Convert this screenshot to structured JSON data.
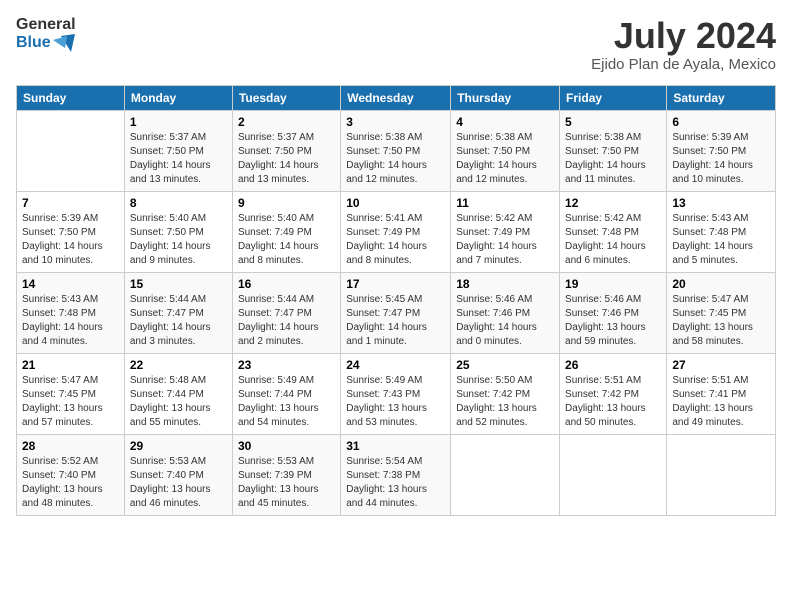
{
  "header": {
    "logo_line1": "General",
    "logo_line2": "Blue",
    "month_title": "July 2024",
    "location": "Ejido Plan de Ayala, Mexico"
  },
  "columns": [
    "Sunday",
    "Monday",
    "Tuesday",
    "Wednesday",
    "Thursday",
    "Friday",
    "Saturday"
  ],
  "weeks": [
    [
      {
        "day": "",
        "info": ""
      },
      {
        "day": "1",
        "info": "Sunrise: 5:37 AM\nSunset: 7:50 PM\nDaylight: 14 hours\nand 13 minutes."
      },
      {
        "day": "2",
        "info": "Sunrise: 5:37 AM\nSunset: 7:50 PM\nDaylight: 14 hours\nand 13 minutes."
      },
      {
        "day": "3",
        "info": "Sunrise: 5:38 AM\nSunset: 7:50 PM\nDaylight: 14 hours\nand 12 minutes."
      },
      {
        "day": "4",
        "info": "Sunrise: 5:38 AM\nSunset: 7:50 PM\nDaylight: 14 hours\nand 12 minutes."
      },
      {
        "day": "5",
        "info": "Sunrise: 5:38 AM\nSunset: 7:50 PM\nDaylight: 14 hours\nand 11 minutes."
      },
      {
        "day": "6",
        "info": "Sunrise: 5:39 AM\nSunset: 7:50 PM\nDaylight: 14 hours\nand 10 minutes."
      }
    ],
    [
      {
        "day": "7",
        "info": "Sunrise: 5:39 AM\nSunset: 7:50 PM\nDaylight: 14 hours\nand 10 minutes."
      },
      {
        "day": "8",
        "info": "Sunrise: 5:40 AM\nSunset: 7:50 PM\nDaylight: 14 hours\nand 9 minutes."
      },
      {
        "day": "9",
        "info": "Sunrise: 5:40 AM\nSunset: 7:49 PM\nDaylight: 14 hours\nand 8 minutes."
      },
      {
        "day": "10",
        "info": "Sunrise: 5:41 AM\nSunset: 7:49 PM\nDaylight: 14 hours\nand 8 minutes."
      },
      {
        "day": "11",
        "info": "Sunrise: 5:42 AM\nSunset: 7:49 PM\nDaylight: 14 hours\nand 7 minutes."
      },
      {
        "day": "12",
        "info": "Sunrise: 5:42 AM\nSunset: 7:48 PM\nDaylight: 14 hours\nand 6 minutes."
      },
      {
        "day": "13",
        "info": "Sunrise: 5:43 AM\nSunset: 7:48 PM\nDaylight: 14 hours\nand 5 minutes."
      }
    ],
    [
      {
        "day": "14",
        "info": "Sunrise: 5:43 AM\nSunset: 7:48 PM\nDaylight: 14 hours\nand 4 minutes."
      },
      {
        "day": "15",
        "info": "Sunrise: 5:44 AM\nSunset: 7:47 PM\nDaylight: 14 hours\nand 3 minutes."
      },
      {
        "day": "16",
        "info": "Sunrise: 5:44 AM\nSunset: 7:47 PM\nDaylight: 14 hours\nand 2 minutes."
      },
      {
        "day": "17",
        "info": "Sunrise: 5:45 AM\nSunset: 7:47 PM\nDaylight: 14 hours\nand 1 minute."
      },
      {
        "day": "18",
        "info": "Sunrise: 5:46 AM\nSunset: 7:46 PM\nDaylight: 14 hours\nand 0 minutes."
      },
      {
        "day": "19",
        "info": "Sunrise: 5:46 AM\nSunset: 7:46 PM\nDaylight: 13 hours\nand 59 minutes."
      },
      {
        "day": "20",
        "info": "Sunrise: 5:47 AM\nSunset: 7:45 PM\nDaylight: 13 hours\nand 58 minutes."
      }
    ],
    [
      {
        "day": "21",
        "info": "Sunrise: 5:47 AM\nSunset: 7:45 PM\nDaylight: 13 hours\nand 57 minutes."
      },
      {
        "day": "22",
        "info": "Sunrise: 5:48 AM\nSunset: 7:44 PM\nDaylight: 13 hours\nand 55 minutes."
      },
      {
        "day": "23",
        "info": "Sunrise: 5:49 AM\nSunset: 7:44 PM\nDaylight: 13 hours\nand 54 minutes."
      },
      {
        "day": "24",
        "info": "Sunrise: 5:49 AM\nSunset: 7:43 PM\nDaylight: 13 hours\nand 53 minutes."
      },
      {
        "day": "25",
        "info": "Sunrise: 5:50 AM\nSunset: 7:42 PM\nDaylight: 13 hours\nand 52 minutes."
      },
      {
        "day": "26",
        "info": "Sunrise: 5:51 AM\nSunset: 7:42 PM\nDaylight: 13 hours\nand 50 minutes."
      },
      {
        "day": "27",
        "info": "Sunrise: 5:51 AM\nSunset: 7:41 PM\nDaylight: 13 hours\nand 49 minutes."
      }
    ],
    [
      {
        "day": "28",
        "info": "Sunrise: 5:52 AM\nSunset: 7:40 PM\nDaylight: 13 hours\nand 48 minutes."
      },
      {
        "day": "29",
        "info": "Sunrise: 5:53 AM\nSunset: 7:40 PM\nDaylight: 13 hours\nand 46 minutes."
      },
      {
        "day": "30",
        "info": "Sunrise: 5:53 AM\nSunset: 7:39 PM\nDaylight: 13 hours\nand 45 minutes."
      },
      {
        "day": "31",
        "info": "Sunrise: 5:54 AM\nSunset: 7:38 PM\nDaylight: 13 hours\nand 44 minutes."
      },
      {
        "day": "",
        "info": ""
      },
      {
        "day": "",
        "info": ""
      },
      {
        "day": "",
        "info": ""
      }
    ]
  ]
}
